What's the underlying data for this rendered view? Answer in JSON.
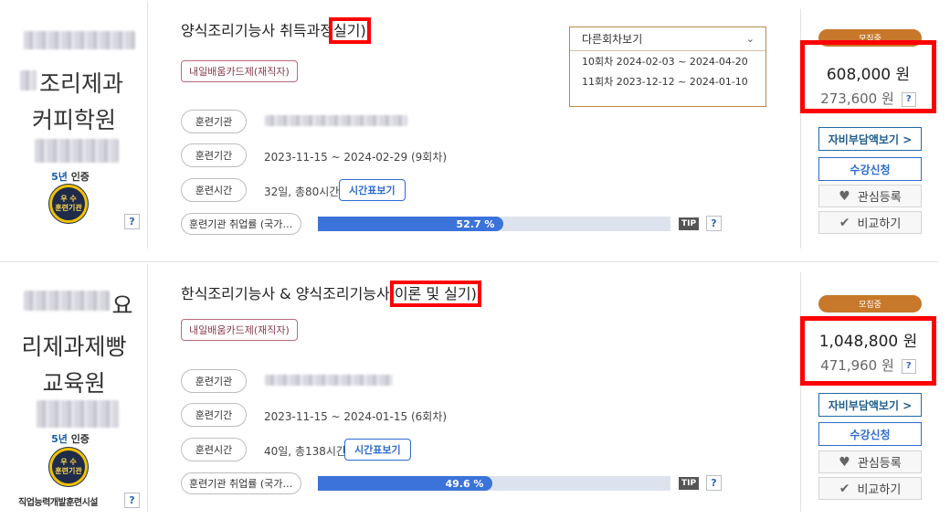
{
  "cards": [
    {
      "institution": {
        "name_line1": "조리제과",
        "name_line2": "커피학원",
        "cert_years": "5년",
        "cert_suffix": "인증",
        "medal_top": "우 수",
        "medal_bottom": "훈련기관",
        "help": "?"
      },
      "title": {
        "main": "양식조리기능사 취득과정",
        "highlight": "실기)"
      },
      "tag": "내일배움카드제(재직자)",
      "rows": {
        "org_label": "훈련기관",
        "period_label": "훈련기간",
        "period": "2023-11-15 ~ 2024-02-29 (9회차)",
        "hours_label": "훈련시간",
        "hours": "32일, 총80시간",
        "timetable_btn": "시간표보기"
      },
      "employment": {
        "label": "훈련기관 취업률 (국가…",
        "rate": 52.7,
        "rate_text": "52.7 %",
        "tip": "TIP",
        "help": "?"
      },
      "rounds": {
        "header": "다른회차보기",
        "items": [
          "10회차 2024-02-03 ~ 2024-04-20",
          "11회차 2023-12-12 ~ 2024-01-10"
        ]
      },
      "side": {
        "status": "모집중",
        "price": "608,000 원",
        "self_pay": "273,600 원",
        "self_pay_help": "?",
        "self_pay_btn": "자비부담액보기 >",
        "apply_btn": "수강신청",
        "wishlist_btn": "관심등록",
        "compare_btn": "비교하기"
      }
    },
    {
      "institution": {
        "name_line0": "요",
        "name_line1": "리제과제빵",
        "name_line2": "교육원",
        "cert_years": "5년",
        "cert_suffix": "인증",
        "medal_top": "우 수",
        "medal_bottom": "훈련기관",
        "facility": "직업능력개발훈련시설",
        "help": "?"
      },
      "title": {
        "main": "한식조리기능사 & 양식조리기능사",
        "highlight": "이론 및 실기)"
      },
      "tag": "내일배움카드제(재직자)",
      "rows": {
        "org_label": "훈련기관",
        "period_label": "훈련기간",
        "period": "2023-11-15 ~ 2024-01-15 (6회차)",
        "hours_label": "훈련시간",
        "hours": "40일, 총138시간",
        "timetable_btn": "시간표보기"
      },
      "employment": {
        "label": "훈련기관 취업률 (국가…",
        "rate": 49.6,
        "rate_text": "49.6 %",
        "tip": "TIP",
        "help": "?"
      },
      "side": {
        "status": "모집중",
        "price": "1,048,800 원",
        "self_pay": "471,960 원",
        "self_pay_help": "?",
        "self_pay_btn": "자비부담액보기 >",
        "apply_btn": "수강신청",
        "wishlist_btn": "관심등록",
        "compare_btn": "비교하기"
      }
    }
  ],
  "icons": {
    "heart": "heart-icon",
    "check": "check-icon",
    "chevron": "chevron-down-icon"
  }
}
